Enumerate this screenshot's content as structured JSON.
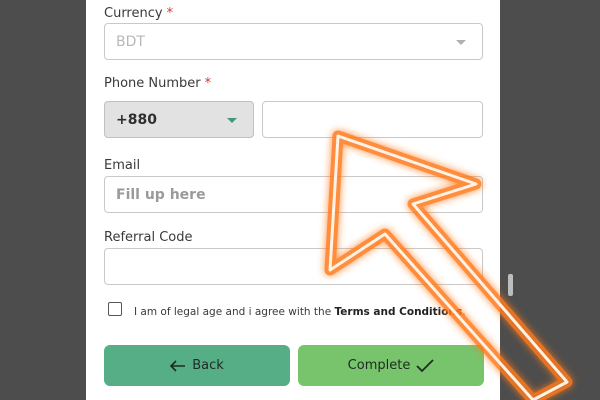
{
  "form": {
    "currency": {
      "label": "Currency",
      "required_mark": "*",
      "selected": "BDT"
    },
    "phone": {
      "label": "Phone Number",
      "required_mark": "*",
      "country_code": "+880",
      "value": ""
    },
    "email": {
      "label": "Email",
      "placeholder": "Fill up here",
      "value": ""
    },
    "referral": {
      "label": "Referral Code",
      "value": ""
    },
    "agree": {
      "checked": false,
      "text": "I am of legal age and i agree with the ",
      "link": "Terms and Conditions",
      "end": "."
    }
  },
  "buttons": {
    "back_label": "Back",
    "complete_label": "Complete"
  },
  "colors": {
    "back_button": "#55ae86",
    "complete_button": "#78c46c",
    "required_star": "#e0322c",
    "overlay_arrow": "#ff7a1a",
    "backdrop": "#4d4d4d"
  },
  "icons": {
    "back": "arrow-left-icon",
    "complete": "checkmark-icon",
    "dropdown": "chevron-down-icon",
    "overlay": "pointer-arrow-overlay"
  }
}
